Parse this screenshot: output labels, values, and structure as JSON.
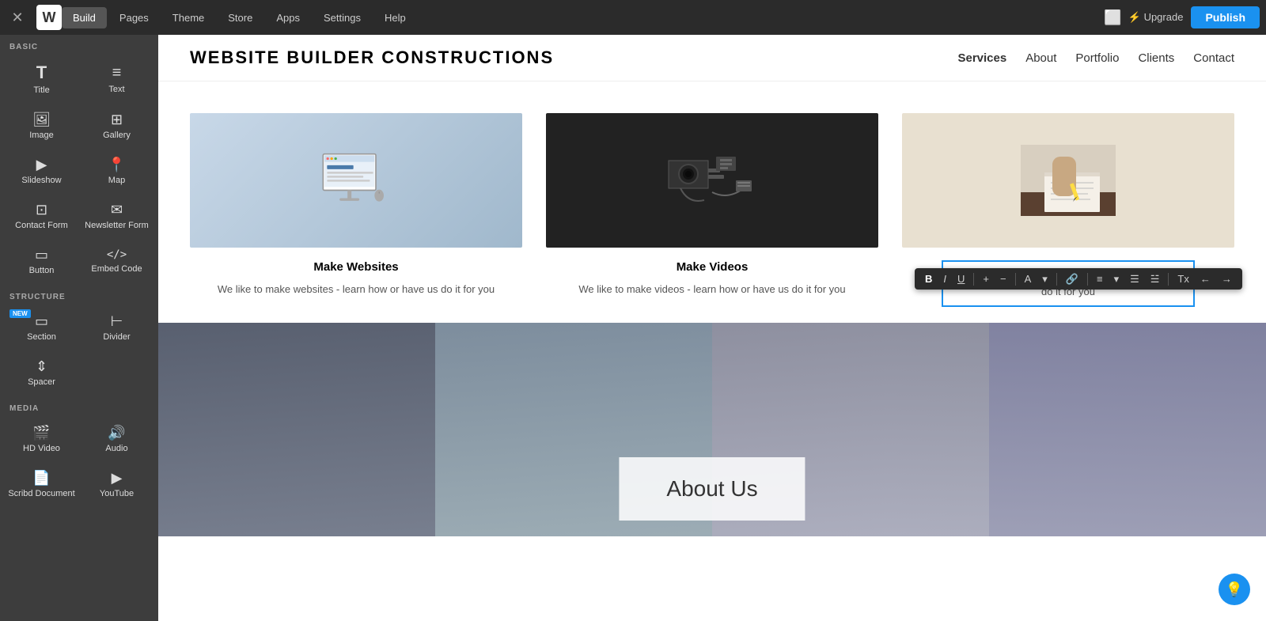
{
  "topnav": {
    "tabs": [
      {
        "label": "Build",
        "active": true
      },
      {
        "label": "Pages",
        "active": false
      },
      {
        "label": "Theme",
        "active": false
      },
      {
        "label": "Store",
        "active": false
      },
      {
        "label": "Apps",
        "active": false
      },
      {
        "label": "Settings",
        "active": false
      },
      {
        "label": "Help",
        "active": false
      }
    ],
    "upgrade_label": "⚡ Upgrade",
    "publish_label": "Publish"
  },
  "sidebar": {
    "sections": {
      "basic_label": "BASIC",
      "structure_label": "STRUCTURE",
      "media_label": "MEDIA"
    },
    "basic_items": [
      {
        "label": "Title",
        "icon": "T"
      },
      {
        "label": "Text",
        "icon": "≡"
      },
      {
        "label": "Image",
        "icon": "⬜"
      },
      {
        "label": "Gallery",
        "icon": "⊞"
      },
      {
        "label": "Slideshow",
        "icon": "▶"
      },
      {
        "label": "Map",
        "icon": "📍"
      },
      {
        "label": "Contact Form",
        "icon": "⊡"
      },
      {
        "label": "Newsletter Form",
        "icon": "✉"
      },
      {
        "label": "Button",
        "icon": "▭"
      },
      {
        "label": "Embed Code",
        "icon": "</>"
      }
    ],
    "structure_items": [
      {
        "label": "Section",
        "icon": "▭",
        "new": true
      },
      {
        "label": "Divider",
        "icon": "—"
      },
      {
        "label": "Spacer",
        "icon": "⇕"
      }
    ],
    "media_items": [
      {
        "label": "HD Video",
        "icon": "▶"
      },
      {
        "label": "Audio",
        "icon": "🔊"
      },
      {
        "label": "Scribd Document",
        "icon": "📄"
      },
      {
        "label": "YouTube",
        "icon": "▶"
      }
    ]
  },
  "site": {
    "logo": "WEBSITE BUILDER CONSTRUCTIONS",
    "nav": [
      "Services",
      "About",
      "Portfolio",
      "Clients",
      "Contact"
    ]
  },
  "services": [
    {
      "title": "Make Websites",
      "desc": "We like to make websites - learn how or have us do it for you",
      "img_type": "websites"
    },
    {
      "title": "Make Videos",
      "desc": "We like to make videos - learn how or have us do it for you",
      "img_type": "videos"
    },
    {
      "title": "",
      "desc": "We like to make blog posts - learn how or have us do it for you",
      "img_type": "blogs"
    }
  ],
  "text_toolbar": {
    "buttons": [
      "B",
      "I",
      "U",
      "+",
      "−",
      "A",
      "▾",
      "🔗",
      "≡",
      "▾",
      "☰",
      "☱",
      "Tx",
      "←",
      "→"
    ]
  },
  "text_edit": {
    "content": "We like to make blog posts - learn how or have us do it for you"
  },
  "about": {
    "title": "About Us"
  },
  "colors": {
    "accent": "#1a91f0",
    "nav_bg": "#2b2b2b",
    "sidebar_bg": "#3d3d3d"
  }
}
